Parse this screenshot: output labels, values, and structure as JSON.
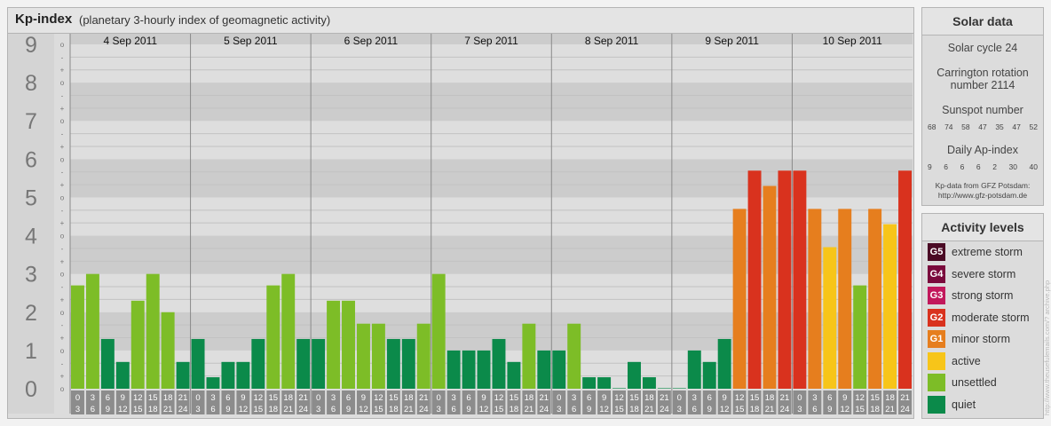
{
  "title": {
    "main": "Kp-index",
    "sub": "(planetary 3-hourly index of geomagnetic activity)"
  },
  "solar": {
    "heading": "Solar data",
    "cycle": "Solar cycle 24",
    "carrington_line1": "Carrington rotation",
    "carrington_line2": "number 2114",
    "sunspot_heading": "Sunspot number",
    "sunspot_values": [
      "68",
      "74",
      "58",
      "47",
      "35",
      "47",
      "52"
    ],
    "ap_heading": "Daily Ap-index",
    "ap_values": [
      "9",
      "6",
      "6",
      "2",
      "30",
      "40"
    ],
    "ap_row": [
      "9",
      "6",
      "6",
      "6",
      "2",
      "30",
      "40"
    ],
    "source_line1": "Kp-data from GFZ Potsdam:",
    "source_line2": "http://www.gfz-potsdam.de"
  },
  "activity": {
    "heading": "Activity levels",
    "levels": [
      {
        "badge": "G5",
        "label": "extreme storm",
        "color": "#4a0a24"
      },
      {
        "badge": "G4",
        "label": "severe storm",
        "color": "#7a0a3c"
      },
      {
        "badge": "G3",
        "label": "strong storm",
        "color": "#c2185b"
      },
      {
        "badge": "G2",
        "label": "moderate storm",
        "color": "#d9321e"
      },
      {
        "badge": "G1",
        "label": "minor storm",
        "color": "#e67e1e"
      },
      {
        "badge": "",
        "label": "active",
        "color": "#f7c519"
      },
      {
        "badge": "",
        "label": "unsettled",
        "color": "#7dbd27"
      },
      {
        "badge": "",
        "label": "quiet",
        "color": "#0b8a4a"
      }
    ]
  },
  "side_credit": "http://www.theusefulemails.com/?   archive.php",
  "chart_data": {
    "type": "bar",
    "title": "Kp-index",
    "subtitle": "(planetary 3-hourly index of geomagnetic activity)",
    "ylim": [
      0,
      9
    ],
    "y_ticks": [
      "0",
      "1",
      "2",
      "3",
      "4",
      "5",
      "6",
      "7",
      "8",
      "9"
    ],
    "y_minor_ticks": [
      "o",
      "+",
      "-",
      "o",
      "+",
      "-",
      "o",
      "+",
      "-",
      "o",
      "+",
      "-",
      "o",
      "+",
      "-",
      "o",
      "+",
      "-",
      "o",
      "+",
      "-",
      "o",
      "+",
      "-",
      "o",
      "+",
      "-",
      "o"
    ],
    "days": [
      "4 Sep 2011",
      "5 Sep 2011",
      "6 Sep 2011",
      "7 Sep 2011",
      "8 Sep 2011",
      "9 Sep 2011",
      "10 Sep 2011"
    ],
    "interval_start_labels": [
      "0",
      "3",
      "6",
      "9",
      "12",
      "15",
      "18",
      "21"
    ],
    "interval_end_labels": [
      "3",
      "6",
      "9",
      "12",
      "15",
      "18",
      "21",
      "24"
    ],
    "values": [
      2.7,
      3.0,
      1.3,
      0.7,
      2.3,
      3.0,
      2.0,
      0.7,
      1.3,
      0.3,
      0.7,
      0.7,
      1.3,
      2.7,
      3.0,
      1.3,
      1.3,
      2.3,
      2.3,
      1.7,
      1.7,
      1.3,
      1.3,
      1.7,
      3.0,
      1.0,
      1.0,
      1.0,
      1.3,
      0.7,
      1.7,
      1.0,
      1.0,
      1.7,
      0.3,
      0.3,
      0.0,
      0.7,
      0.3,
      0.0,
      0.0,
      1.0,
      0.7,
      1.3,
      4.7,
      5.7,
      5.3,
      5.7,
      5.7,
      4.7,
      3.7,
      4.7,
      2.7,
      4.7,
      4.3,
      5.7
    ],
    "level_colors": {
      "quiet": "#0b8a4a",
      "unsettled": "#7dbd27",
      "active": "#f7c519",
      "minor": "#e67e1e",
      "moderate": "#d9321e"
    },
    "grid": true
  }
}
